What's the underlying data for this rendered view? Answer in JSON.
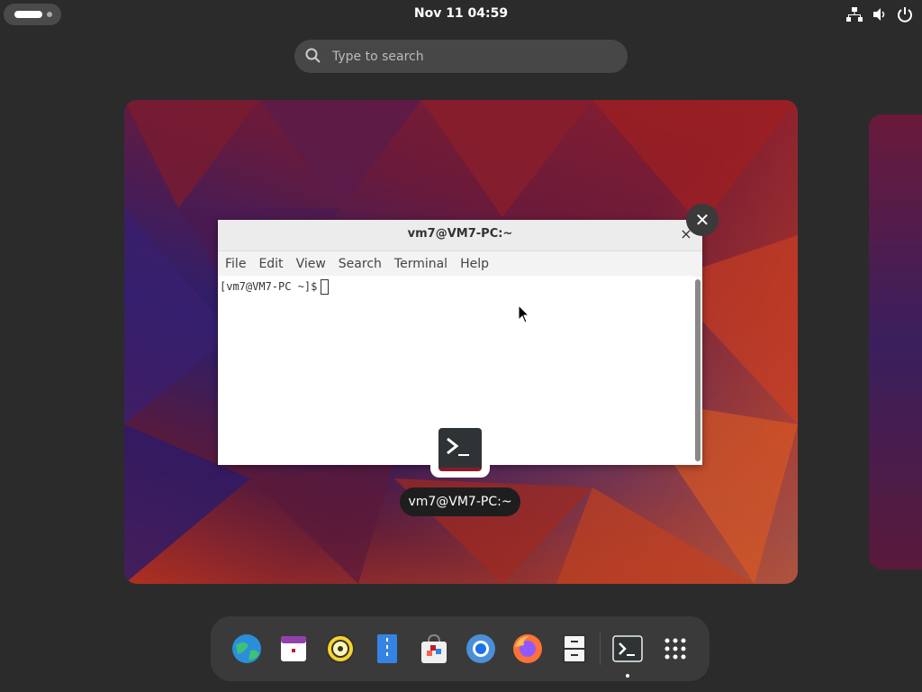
{
  "topbar": {
    "clock": "Nov 11  04:59"
  },
  "search": {
    "placeholder": "Type to search"
  },
  "terminal": {
    "title": "vm7@VM7-PC:~",
    "menu": [
      "File",
      "Edit",
      "View",
      "Search",
      "Terminal",
      "Help"
    ],
    "prompt": "[vm7@VM7-PC ~]$"
  },
  "window_label": "vm7@VM7-PC:~",
  "dock": {
    "apps": [
      {
        "name": "browser-globe-icon"
      },
      {
        "name": "calendar-icon"
      },
      {
        "name": "music-icon"
      },
      {
        "name": "text-editor-icon"
      },
      {
        "name": "software-store-icon"
      },
      {
        "name": "chromium-icon"
      },
      {
        "name": "firefox-icon"
      },
      {
        "name": "file-cabinet-icon"
      },
      {
        "name": "terminal-icon"
      },
      {
        "name": "app-grid-icon"
      }
    ]
  },
  "colors": {
    "accent": "#3a3a3a",
    "terminal_bar": "#ececec"
  }
}
